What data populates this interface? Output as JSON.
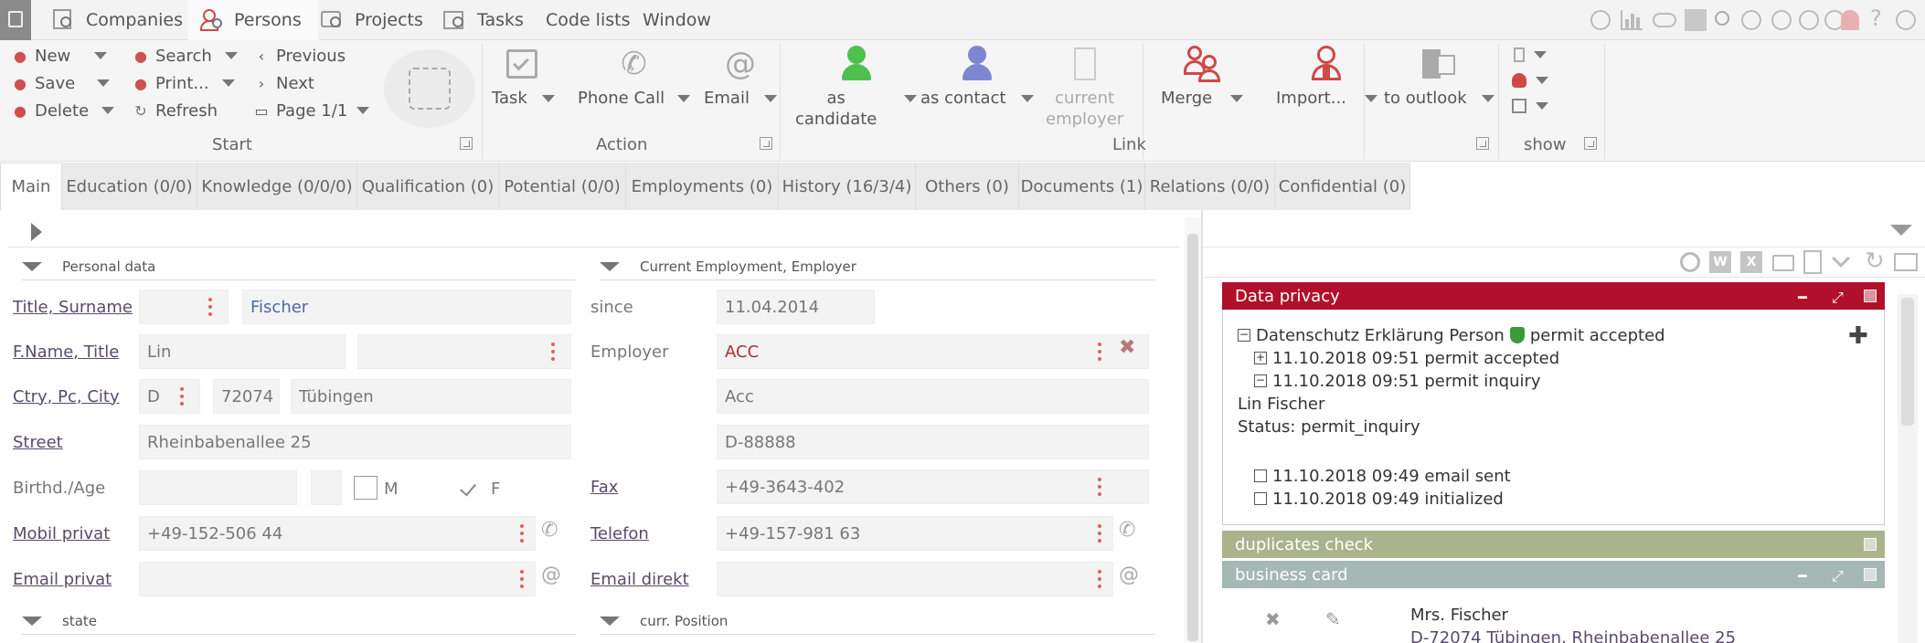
{
  "menu": {
    "items": [
      {
        "label": "Companies"
      },
      {
        "label": "Persons"
      },
      {
        "label": "Projects"
      },
      {
        "label": "Tasks"
      },
      {
        "label": "Code lists"
      },
      {
        "label": "Window"
      }
    ]
  },
  "ribbon": {
    "start": {
      "new": "New",
      "save": "Save",
      "delete": "Delete",
      "search": "Search",
      "print": "Print...",
      "refresh": "Refresh",
      "previous": "Previous",
      "next": "Next",
      "page": "Page 1/1",
      "label": "Start"
    },
    "action": {
      "task": "Task",
      "phone": "Phone Call",
      "email": "Email",
      "label": "Action"
    },
    "link": {
      "as_candidate_1": "as",
      "as_candidate_2": "candidate",
      "as_contact": "as contact",
      "current_employer_1": "current",
      "current_employer_2": "employer",
      "merge": "Merge",
      "import": "Import...",
      "to_outlook": "to outlook",
      "label": "Link"
    },
    "show": {
      "label": "show"
    }
  },
  "tabs": [
    "Main",
    "Education (0/0)",
    "Knowledge (0/0/0)",
    "Qualification (0)",
    "Potential (0/0)",
    "Employments (0)",
    "History (16/3/4)",
    "Others (0)",
    "Documents (1)",
    "Relations (0/0)",
    "Confidential (0)"
  ],
  "form": {
    "personal_data": "Personal data",
    "current_employment": "Current Employment, Employer",
    "state": "state",
    "curr_position": "curr. Position",
    "labels": {
      "title_surname": "Title, Surname",
      "fname_title": "F.Name, Title",
      "ctry_pc_city": "Ctry, Pc, City",
      "street": "Street",
      "birthd_age": "Birthd./Age",
      "mobil_privat": "Mobil privat",
      "email_privat": "Email privat",
      "since": "since",
      "employer": "Employer",
      "fax": "Fax",
      "telefon": "Telefon",
      "email_direkt": "Email direkt"
    },
    "values": {
      "surname": "Fischer",
      "first_name": "Lin",
      "country": "D",
      "postcode": "72074",
      "city": "Tübingen",
      "street": "Rheinbabenallee 25",
      "gender_m": "M",
      "gender_f": "F",
      "mobil": "+49-152-506 44",
      "since": "11.04.2014",
      "employer": "ACC",
      "employer_name": "Acc",
      "employer_postal": "D-88888",
      "fax": "+49-3643-402",
      "telefon": "+49-157-981 63"
    }
  },
  "right_panel": {
    "data_privacy": {
      "title": "Data privacy",
      "root": "Datenschutz Erklärung Person",
      "root_status": "permit accepted",
      "entries": [
        {
          "text": "11.10.2018 09:51 permit accepted"
        },
        {
          "text": "11.10.2018 09:51 permit inquiry"
        }
      ],
      "person": "Lin Fischer",
      "status": "Status: permit_inquiry",
      "events": [
        {
          "text": "11.10.2018 09:49 email sent"
        },
        {
          "text": "11.10.2018 09:49 initialized"
        }
      ]
    },
    "duplicates_check": {
      "title": "duplicates check"
    },
    "business_card": {
      "title": "business card",
      "name": "Mrs. Fischer",
      "address": "D-72074 Tübingen, Rheinbabenallee 25"
    }
  },
  "colors": {
    "data_privacy_header": "#b0102a",
    "duplicates_header": "#aab48c",
    "business_card_header": "#a4b8b4",
    "accent_red": "#e06060"
  }
}
